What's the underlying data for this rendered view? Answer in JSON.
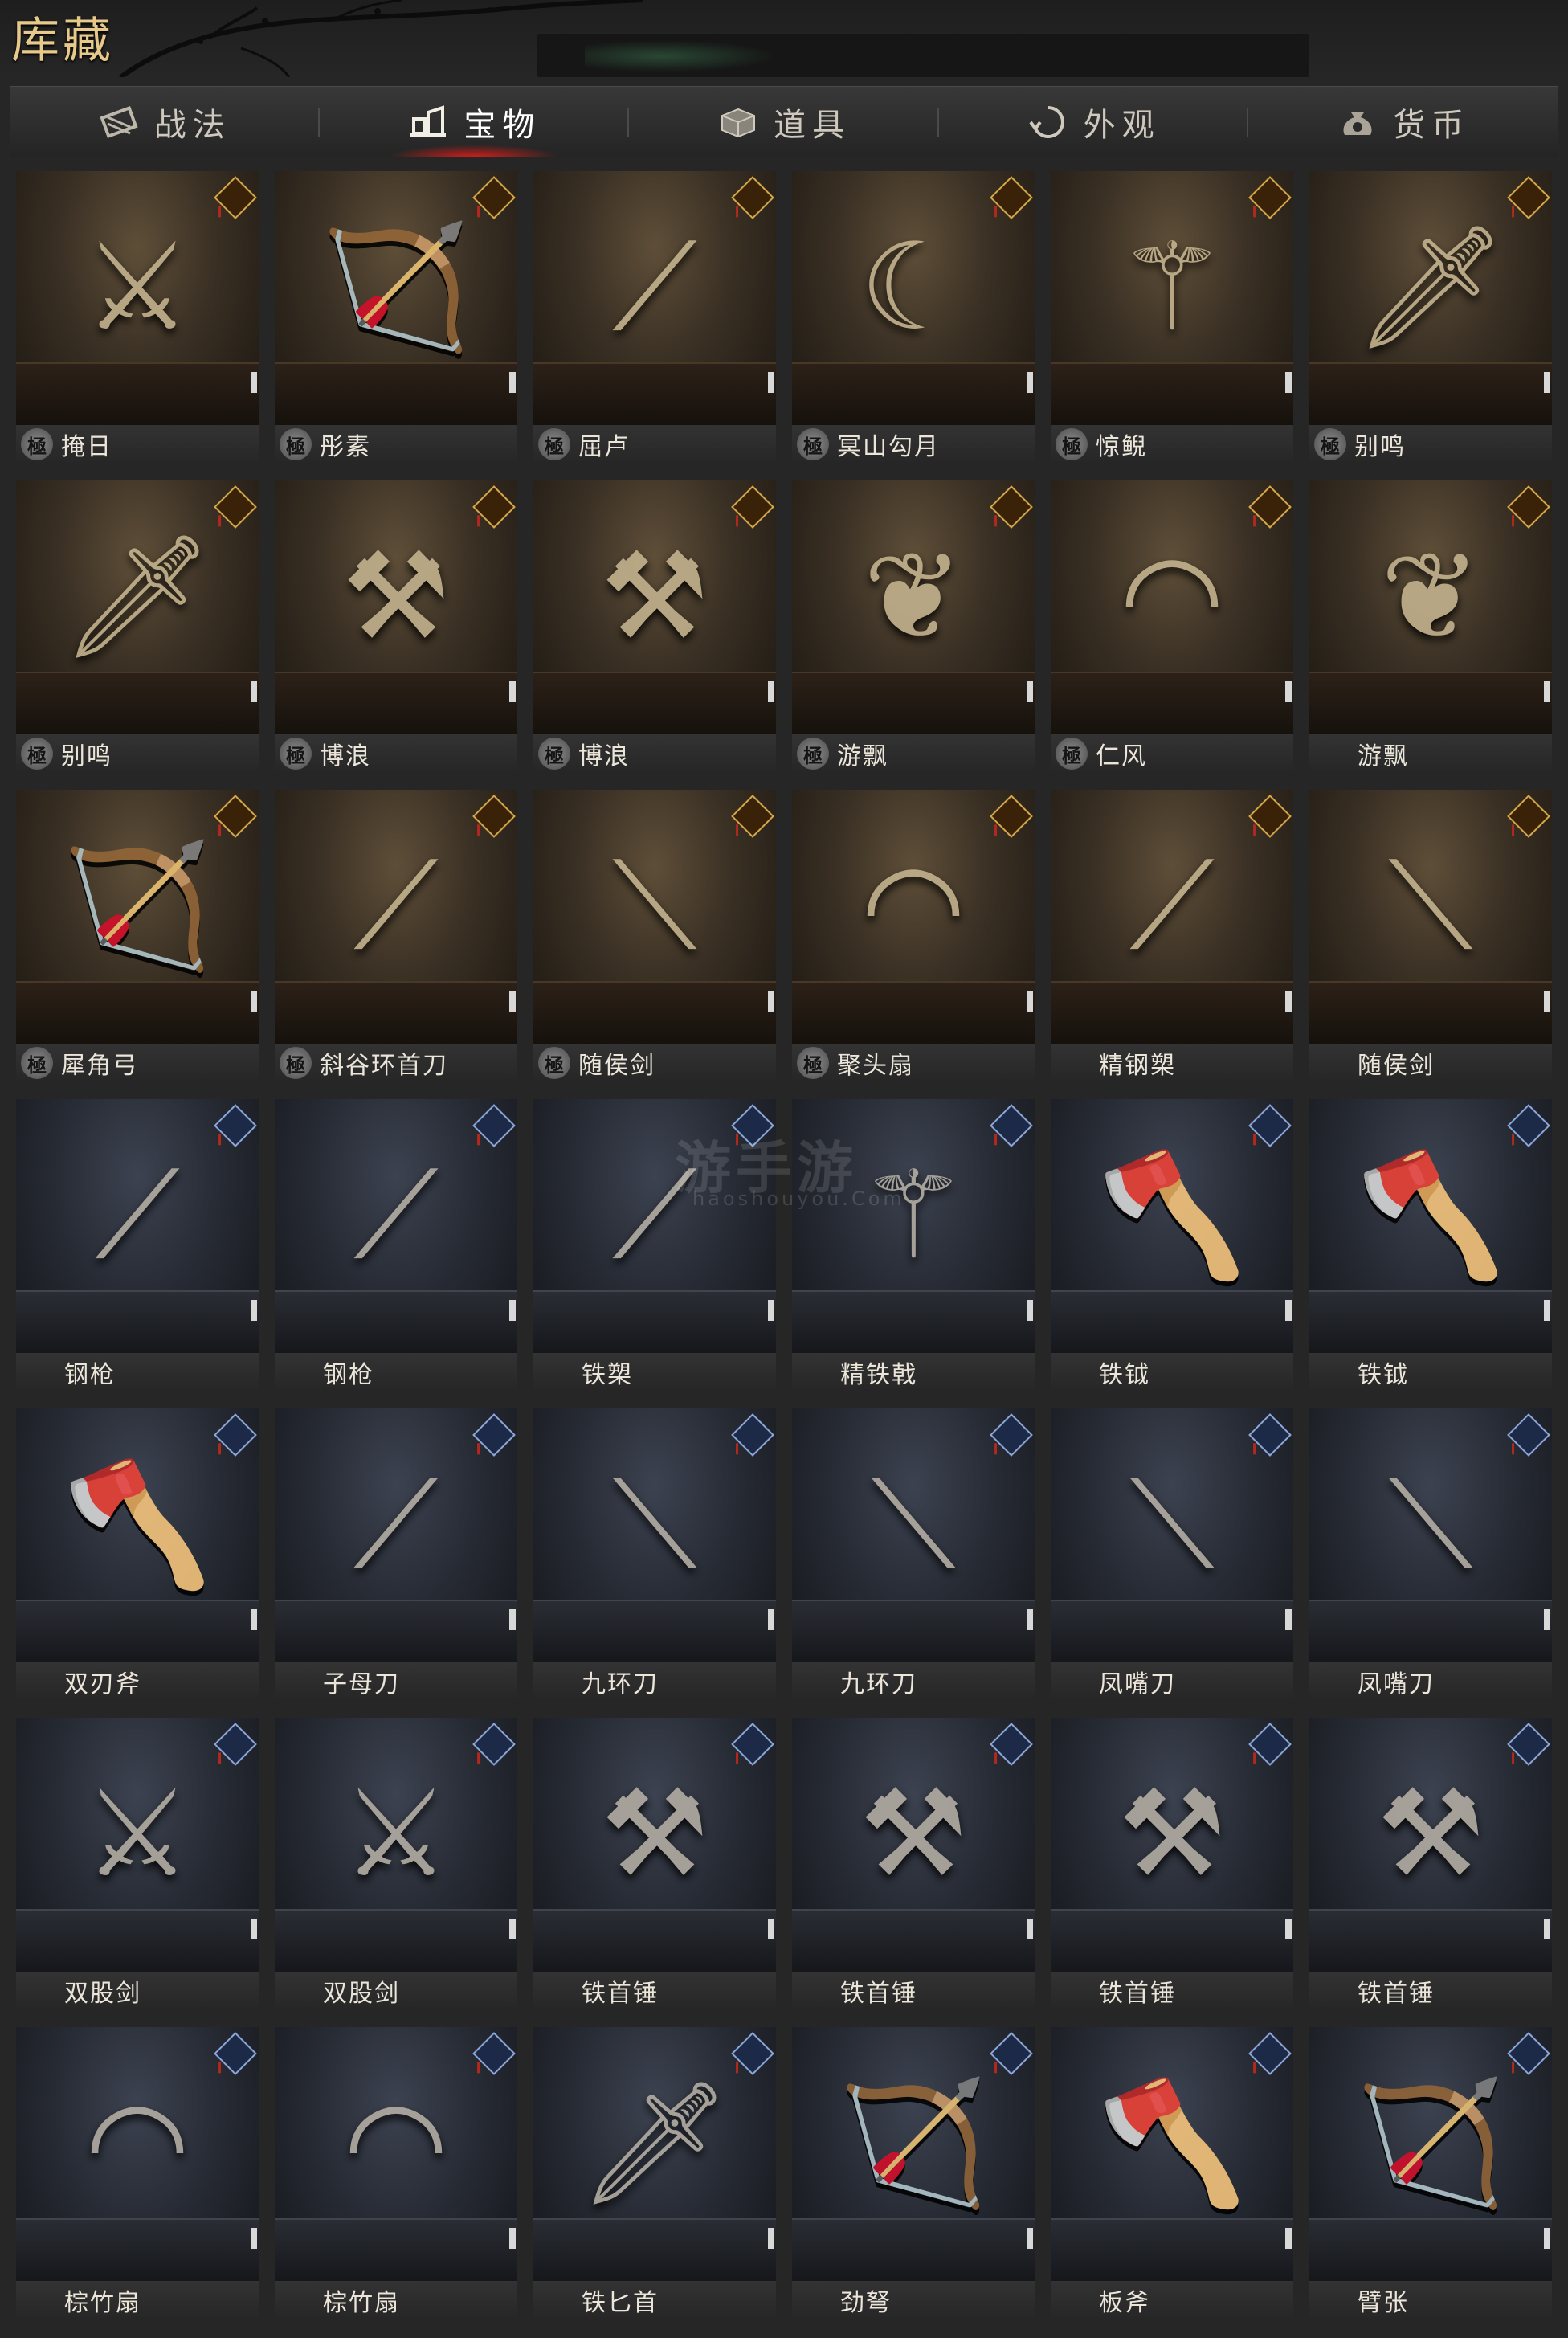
{
  "header": {
    "title": "库藏"
  },
  "tabs": [
    {
      "label": "战法",
      "icon": "tactics-icon",
      "active": false
    },
    {
      "label": "宝物",
      "icon": "treasure-icon",
      "active": true
    },
    {
      "label": "道具",
      "icon": "chest-icon",
      "active": false
    },
    {
      "label": "外观",
      "icon": "appearance-icon",
      "active": false
    },
    {
      "label": "货币",
      "icon": "money-bag-icon",
      "active": false
    }
  ],
  "grid_badge": "極",
  "items": [
    {
      "name": "掩日",
      "badge": true,
      "theme": "warm",
      "glyph": "⚔"
    },
    {
      "name": "彤素",
      "badge": true,
      "theme": "warm",
      "glyph": "🏹"
    },
    {
      "name": "屈卢",
      "badge": true,
      "theme": "warm",
      "glyph": "⟋"
    },
    {
      "name": "冥山勾月",
      "badge": true,
      "theme": "warm",
      "glyph": "☾"
    },
    {
      "name": "惊鲵",
      "badge": true,
      "theme": "warm",
      "glyph": "⚚"
    },
    {
      "name": "别鸣",
      "badge": true,
      "theme": "warm",
      "glyph": "🗡"
    },
    {
      "name": "别鸣",
      "badge": true,
      "theme": "warm",
      "glyph": "🗡"
    },
    {
      "name": "博浪",
      "badge": true,
      "theme": "warm",
      "glyph": "⚒"
    },
    {
      "name": "博浪",
      "badge": true,
      "theme": "warm",
      "glyph": "⚒"
    },
    {
      "name": "游飘",
      "badge": true,
      "theme": "warm",
      "glyph": "❦"
    },
    {
      "name": "仁风",
      "badge": true,
      "theme": "warm",
      "glyph": "◠"
    },
    {
      "name": "游飘",
      "badge": false,
      "theme": "warm",
      "glyph": "❦"
    },
    {
      "name": "犀角弓",
      "badge": true,
      "theme": "warm",
      "glyph": "🏹"
    },
    {
      "name": "斜谷环首刀",
      "badge": true,
      "theme": "warm",
      "glyph": "⟋"
    },
    {
      "name": "随侯剑",
      "badge": true,
      "theme": "warm",
      "glyph": "⟍"
    },
    {
      "name": "聚头扇",
      "badge": true,
      "theme": "warm",
      "glyph": "◠"
    },
    {
      "name": "精钢槊",
      "badge": false,
      "theme": "warm",
      "glyph": "⟋"
    },
    {
      "name": "随侯剑",
      "badge": false,
      "theme": "warm",
      "glyph": "⟍"
    },
    {
      "name": "钢枪",
      "badge": false,
      "theme": "cool",
      "glyph": "⟋"
    },
    {
      "name": "钢枪",
      "badge": false,
      "theme": "cool",
      "glyph": "⟋"
    },
    {
      "name": "铁槊",
      "badge": false,
      "theme": "cool",
      "glyph": "⟋"
    },
    {
      "name": "精铁戟",
      "badge": false,
      "theme": "cool",
      "glyph": "⚚"
    },
    {
      "name": "铁钺",
      "badge": false,
      "theme": "cool",
      "glyph": "🪓"
    },
    {
      "name": "铁钺",
      "badge": false,
      "theme": "cool",
      "glyph": "🪓"
    },
    {
      "name": "双刃斧",
      "badge": false,
      "theme": "cool",
      "glyph": "🪓"
    },
    {
      "name": "子母刀",
      "badge": false,
      "theme": "cool",
      "glyph": "⟋"
    },
    {
      "name": "九环刀",
      "badge": false,
      "theme": "cool",
      "glyph": "⟍"
    },
    {
      "name": "九环刀",
      "badge": false,
      "theme": "cool",
      "glyph": "⟍"
    },
    {
      "name": "凤嘴刀",
      "badge": false,
      "theme": "cool",
      "glyph": "⟍"
    },
    {
      "name": "凤嘴刀",
      "badge": false,
      "theme": "cool",
      "glyph": "⟍"
    },
    {
      "name": "双股剑",
      "badge": false,
      "theme": "cool",
      "glyph": "⚔"
    },
    {
      "name": "双股剑",
      "badge": false,
      "theme": "cool",
      "glyph": "⚔"
    },
    {
      "name": "铁首锤",
      "badge": false,
      "theme": "cool",
      "glyph": "⚒"
    },
    {
      "name": "铁首锤",
      "badge": false,
      "theme": "cool",
      "glyph": "⚒"
    },
    {
      "name": "铁首锤",
      "badge": false,
      "theme": "cool",
      "glyph": "⚒"
    },
    {
      "name": "铁首锤",
      "badge": false,
      "theme": "cool",
      "glyph": "⚒"
    },
    {
      "name": "棕竹扇",
      "badge": false,
      "theme": "cool",
      "glyph": "◠"
    },
    {
      "name": "棕竹扇",
      "badge": false,
      "theme": "cool",
      "glyph": "◠"
    },
    {
      "name": "铁匕首",
      "badge": false,
      "theme": "cool",
      "glyph": "🗡"
    },
    {
      "name": "劲弩",
      "badge": false,
      "theme": "cool",
      "glyph": "🏹"
    },
    {
      "name": "板斧",
      "badge": false,
      "theme": "cool",
      "glyph": "🪓"
    },
    {
      "name": "臂张",
      "badge": false,
      "theme": "cool",
      "glyph": "🏹"
    }
  ],
  "watermark": {
    "text": "游手游",
    "sub": "haoshouyou.Com"
  }
}
